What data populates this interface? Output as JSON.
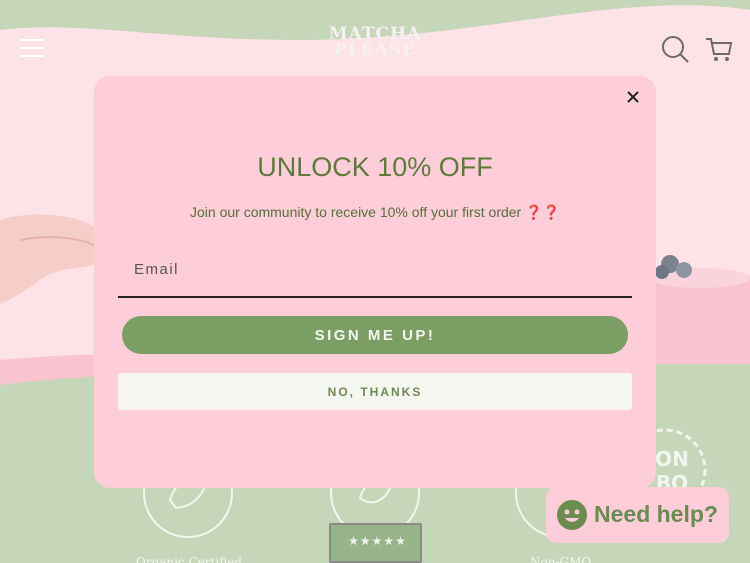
{
  "header": {
    "logo_line1": "MATCHA",
    "logo_line2": "PLEASE"
  },
  "modal": {
    "title": "UNLOCK 10% OFF",
    "subtitle": "Join our community to receive 10% off your first order",
    "subtitle_emoji": "❓❓",
    "email_placeholder": "Email",
    "signup_label": "SIGN ME UP!",
    "decline_label": "NO, THANKS"
  },
  "features": {
    "left_label": "Organic Certified",
    "right_label": "Non-GMO",
    "badge_text": "ON\nBO"
  },
  "reviews": {
    "stars": "★★★★★"
  },
  "help": {
    "label": "Need help?"
  },
  "colors": {
    "pink_bg": "#fde3e8",
    "modal_bg": "#fdcdd9",
    "green": "#7a9e63",
    "sage": "#c6d6b8",
    "title_green": "#5e7a3a"
  }
}
